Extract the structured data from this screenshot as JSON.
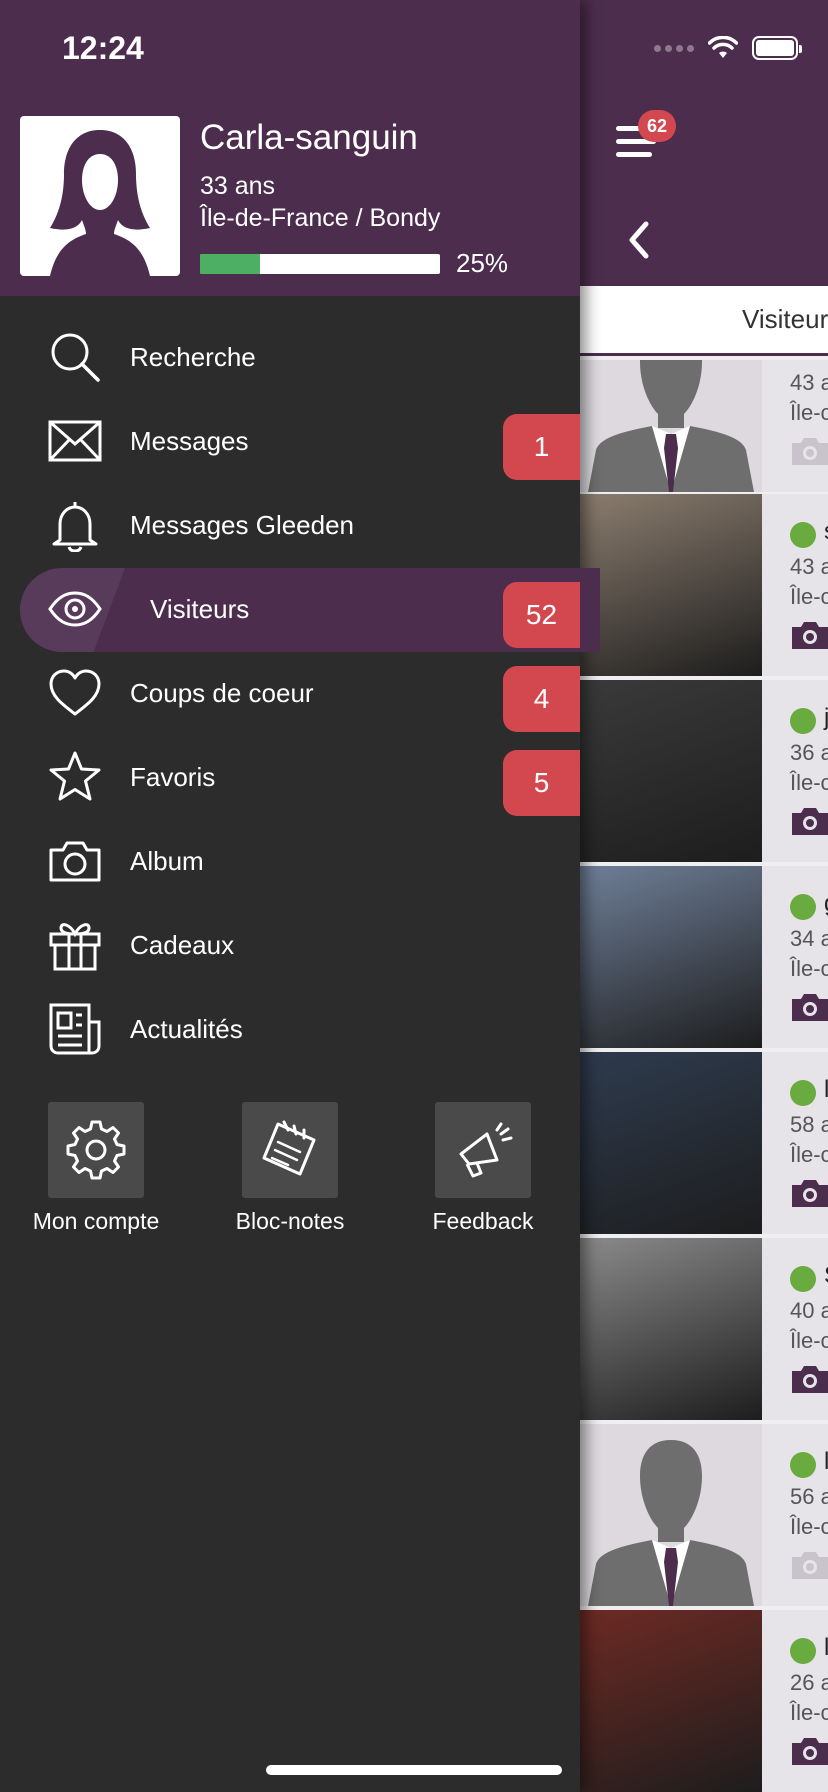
{
  "status_bar": {
    "time": "12:24"
  },
  "header": {
    "notification_count": "62"
  },
  "tab": {
    "label": "Visiteurs"
  },
  "profile": {
    "username": "Carla-sanguin",
    "age": "33 ans",
    "location": "Île-de-France / Bondy",
    "completion_percent": 25,
    "completion_label": "25%"
  },
  "menu": [
    {
      "label": "Recherche",
      "icon": "search-icon"
    },
    {
      "label": "Messages",
      "icon": "envelope-icon",
      "badge": "1"
    },
    {
      "label": "Messages Gleeden",
      "icon": "bell-icon"
    },
    {
      "label": "Visiteurs",
      "icon": "eye-icon",
      "badge": "52",
      "active": true
    },
    {
      "label": "Coups de coeur",
      "icon": "heart-icon",
      "badge": "4"
    },
    {
      "label": "Favoris",
      "icon": "star-icon",
      "badge": "5"
    },
    {
      "label": "Album",
      "icon": "camera-icon"
    },
    {
      "label": "Cadeaux",
      "icon": "gift-icon"
    },
    {
      "label": "Actualités",
      "icon": "newspaper-icon"
    }
  ],
  "tiles": [
    {
      "label": "Mon compte",
      "icon": "gear-icon"
    },
    {
      "label": "Bloc-notes",
      "icon": "notepad-icon"
    },
    {
      "label": "Feedback",
      "icon": "megaphone-icon"
    }
  ],
  "visitors": [
    {
      "initial": "",
      "age": "43 a",
      "region": "Île-c",
      "online": false,
      "photo": "silhouette"
    },
    {
      "initial": "s",
      "age": "43 a",
      "region": "Île-c",
      "online": true,
      "photo": "photo"
    },
    {
      "initial": "j",
      "age": "36 a",
      "region": "Île-c",
      "online": true,
      "photo": "photo"
    },
    {
      "initial": "g",
      "age": "34 a",
      "region": "Île-c",
      "online": true,
      "photo": "photo"
    },
    {
      "initial": "l",
      "age": "58 a",
      "region": "Île-c",
      "online": true,
      "photo": "photo"
    },
    {
      "initial": "S",
      "age": "40 a",
      "region": "Île-c",
      "online": true,
      "photo": "photo"
    },
    {
      "initial": "l",
      "age": "56 a",
      "region": "Île-c",
      "online": true,
      "photo": "silhouette"
    },
    {
      "initial": "l",
      "age": "26 a",
      "region": "Île-c",
      "online": true,
      "photo": "photo"
    }
  ],
  "colors": {
    "brand_purple": "#4c2d4d",
    "drawer_bg": "#2c2c2d",
    "badge_red": "#d3484f",
    "progress_green": "#4caf63",
    "online_green": "#6aab3f"
  }
}
